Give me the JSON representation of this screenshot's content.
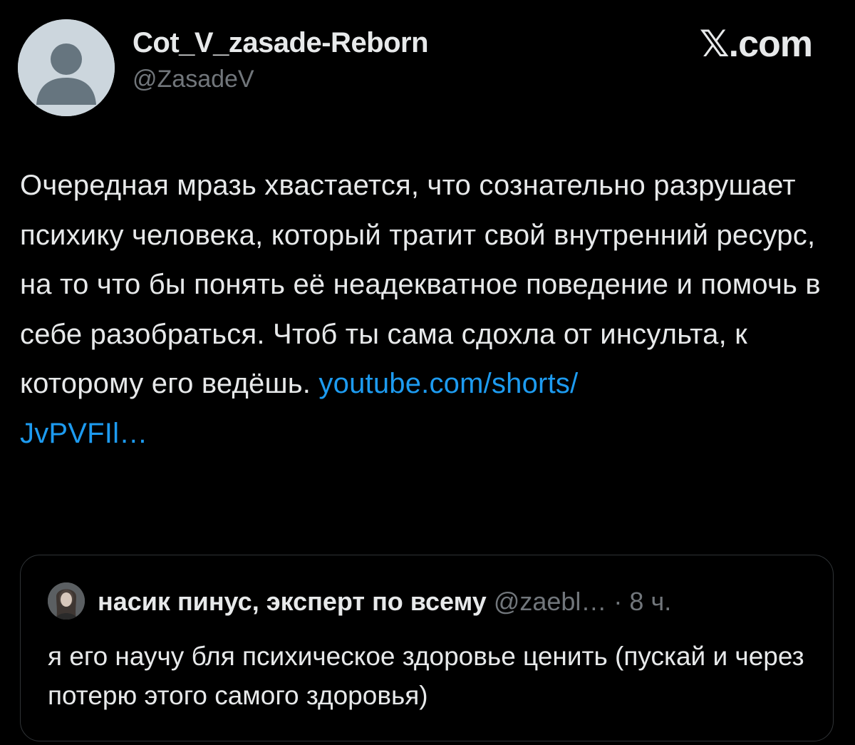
{
  "author": {
    "display_name": "Cot_V_zasade-Reborn",
    "handle": "@ZasadeV",
    "avatar_icon": "default-avatar-icon"
  },
  "brand": {
    "logo_text": "𝕏.com"
  },
  "tweet": {
    "text": "Очередная мразь хвастается, что сознательно разрушает психику человека, который тратит свой внутренний ресурс, на то что бы понять её неадекватное поведение и помочь в себе разобраться. Чтоб ты сама сдохла от инсульта, к которому его ведёшь. ",
    "link": "youtube.com/shorts/\nJvPVFIl…",
    "link_color": "#1d9bf0"
  },
  "quote": {
    "display_name": "насик пинус, эксперт по всему",
    "handle": "@zaebl…",
    "separator": " · ",
    "time": "8 ч.",
    "text": "я его научу бля психическое здоровье ценить (пускай и через потерю этого самого здоровья)"
  },
  "colors": {
    "background": "#000000",
    "text_primary": "#e7e9ea",
    "text_secondary": "#71767b",
    "border": "#2f3336"
  }
}
